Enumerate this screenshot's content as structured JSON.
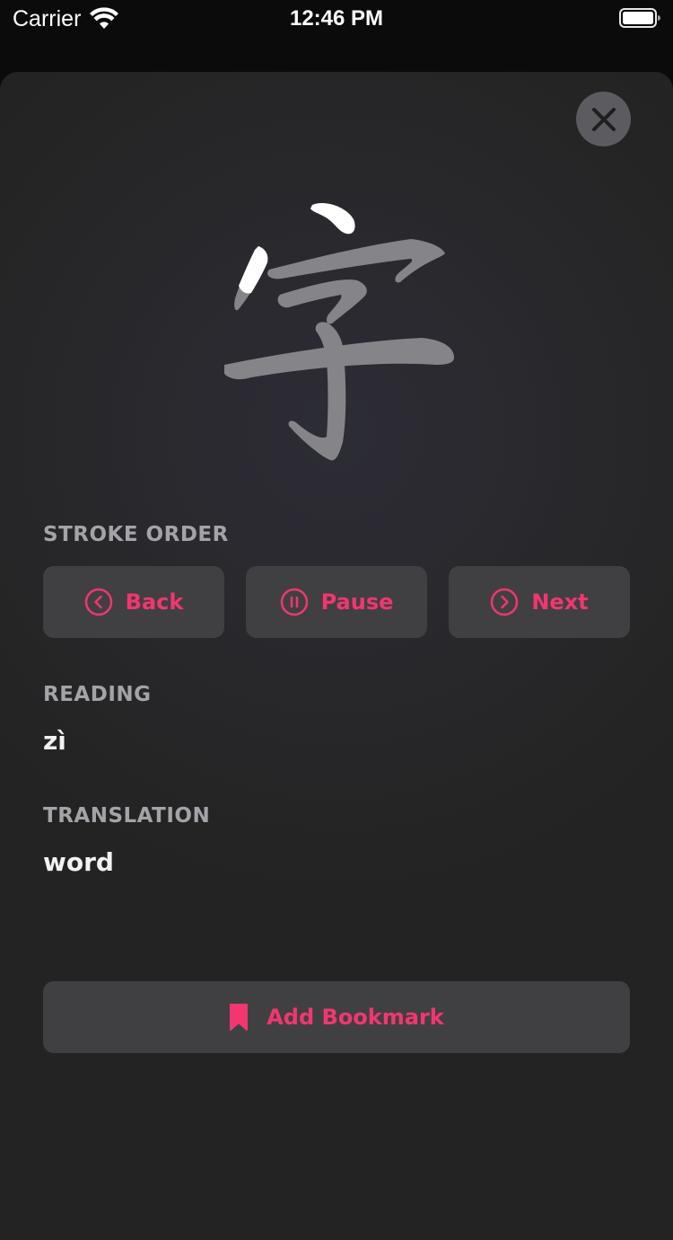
{
  "status_bar": {
    "carrier": "Carrier",
    "time": "12:46 PM",
    "icons": [
      "wifi-icon",
      "battery-icon"
    ]
  },
  "character": {
    "glyph": "字",
    "strokes_total": 6,
    "strokes_highlighted": 2,
    "highlight_color": "#ffffff",
    "stroke_color": "#858589"
  },
  "stroke_order": {
    "label": "STROKE ORDER",
    "back_label": "Back",
    "pause_label": "Pause",
    "next_label": "Next",
    "back_icon": "chevron-left-circle-icon",
    "pause_icon": "pause-circle-icon",
    "next_icon": "chevron-right-circle-icon"
  },
  "reading": {
    "label": "READING",
    "value": "zì"
  },
  "translation": {
    "label": "TRANSLATION",
    "value": "word"
  },
  "bookmark": {
    "label": "Add Bookmark",
    "icon": "bookmark-icon"
  },
  "close_icon": "close-icon",
  "colors": {
    "accent": "#f2366f",
    "button_bg": "#404043",
    "label": "#a3a3a8",
    "value": "#f2f2f2"
  }
}
